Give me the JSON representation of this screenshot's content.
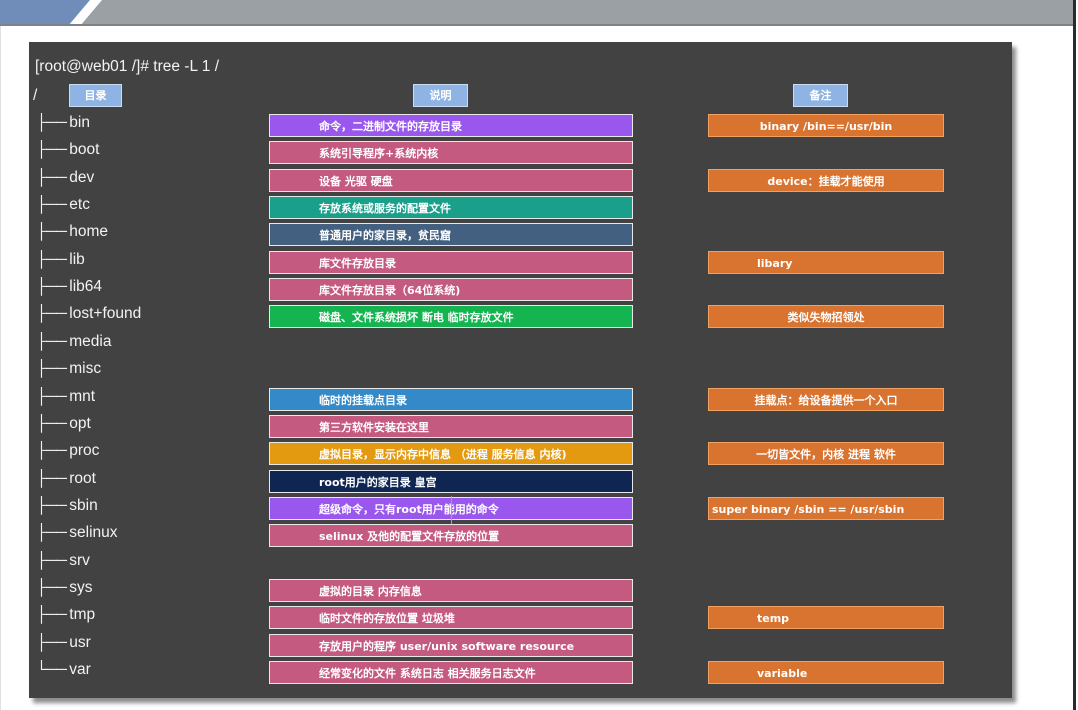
{
  "prompt": "[root@web01 /]# tree -L 1 /",
  "root": "/",
  "headers": {
    "dir": "目录",
    "desc": "说明",
    "note": "备注"
  },
  "colors": {
    "purple": "#9a57ee",
    "pink": "#c45a7f",
    "teal": "#1aa08a",
    "slate": "#436080",
    "green": "#14b450",
    "blue": "#3489c8",
    "amber": "#e39a10",
    "navy": "#0f2652",
    "orange": "#d97330",
    "panel": "#424242",
    "header": "#8fb4e3"
  },
  "entries": [
    {
      "branch": "├──",
      "name": "bin",
      "desc": "命令，二进制文件的存放目录",
      "color": "purple",
      "note": "binary /bin==/usr/bin"
    },
    {
      "branch": "├──",
      "name": "boot",
      "desc": "系统引导程序+系统内核",
      "color": "pink",
      "note": ""
    },
    {
      "branch": "├──",
      "name": "dev",
      "desc": "设备 光驱 硬盘",
      "color": "pink",
      "note": "device：挂载才能使用"
    },
    {
      "branch": "├──",
      "name": "etc",
      "desc": "存放系统或服务的配置文件",
      "color": "teal",
      "note": ""
    },
    {
      "branch": "├──",
      "name": "home",
      "desc": "普通用户的家目录，贫民窟",
      "color": "slate",
      "note": ""
    },
    {
      "branch": "├──",
      "name": "lib",
      "desc": "库文件存放目录",
      "color": "pink",
      "note": "libary"
    },
    {
      "branch": "├──",
      "name": "lib64",
      "desc": "库文件存放目录（64位系统)",
      "color": "pink",
      "note": ""
    },
    {
      "branch": "├──",
      "name": "lost+found",
      "desc": "磁盘、文件系统损坏 断电 临时存放文件",
      "color": "green",
      "note": "类似失物招领处"
    },
    {
      "branch": "├──",
      "name": "media",
      "desc": "",
      "color": "",
      "note": ""
    },
    {
      "branch": "├──",
      "name": "misc",
      "desc": "",
      "color": "",
      "note": ""
    },
    {
      "branch": "├──",
      "name": "mnt",
      "desc": "临时的挂载点目录",
      "color": "blue",
      "note": "挂载点：给设备提供一个入口"
    },
    {
      "branch": "├──",
      "name": "opt",
      "desc": "第三方软件安装在这里",
      "color": "pink",
      "note": ""
    },
    {
      "branch": "├──",
      "name": "proc",
      "desc": "虚拟目录，显示内存中信息 （进程 服务信息 内核)",
      "color": "amber",
      "note": "一切皆文件，内核 进程 软件"
    },
    {
      "branch": "├──",
      "name": "root",
      "desc": "root用户的家目录 皇宫",
      "color": "navy",
      "note": ""
    },
    {
      "branch": "├──",
      "name": "sbin",
      "desc": "超级命令，只有root用户能用的命令",
      "color": "purple",
      "note": "super binary /sbin == /usr/sbin"
    },
    {
      "branch": "├──",
      "name": "selinux",
      "desc": "selinux 及他的配置文件存放的位置",
      "color": "pink",
      "note": ""
    },
    {
      "branch": "├──",
      "name": "srv",
      "desc": "",
      "color": "",
      "note": ""
    },
    {
      "branch": "├──",
      "name": "sys",
      "desc": "虚拟的目录 内存信息",
      "color": "pink",
      "note": ""
    },
    {
      "branch": "├──",
      "name": "tmp",
      "desc": "临时文件的存放位置 垃圾堆",
      "color": "pink",
      "note": "temp"
    },
    {
      "branch": "├──",
      "name": "usr",
      "desc": "存放用户的程序 user/unix software resource",
      "color": "pink",
      "note": ""
    },
    {
      "branch": "└──",
      "name": "var",
      "desc": "经常变化的文件 系统日志 相关服务日志文件",
      "color": "pink",
      "note": "variable"
    }
  ]
}
